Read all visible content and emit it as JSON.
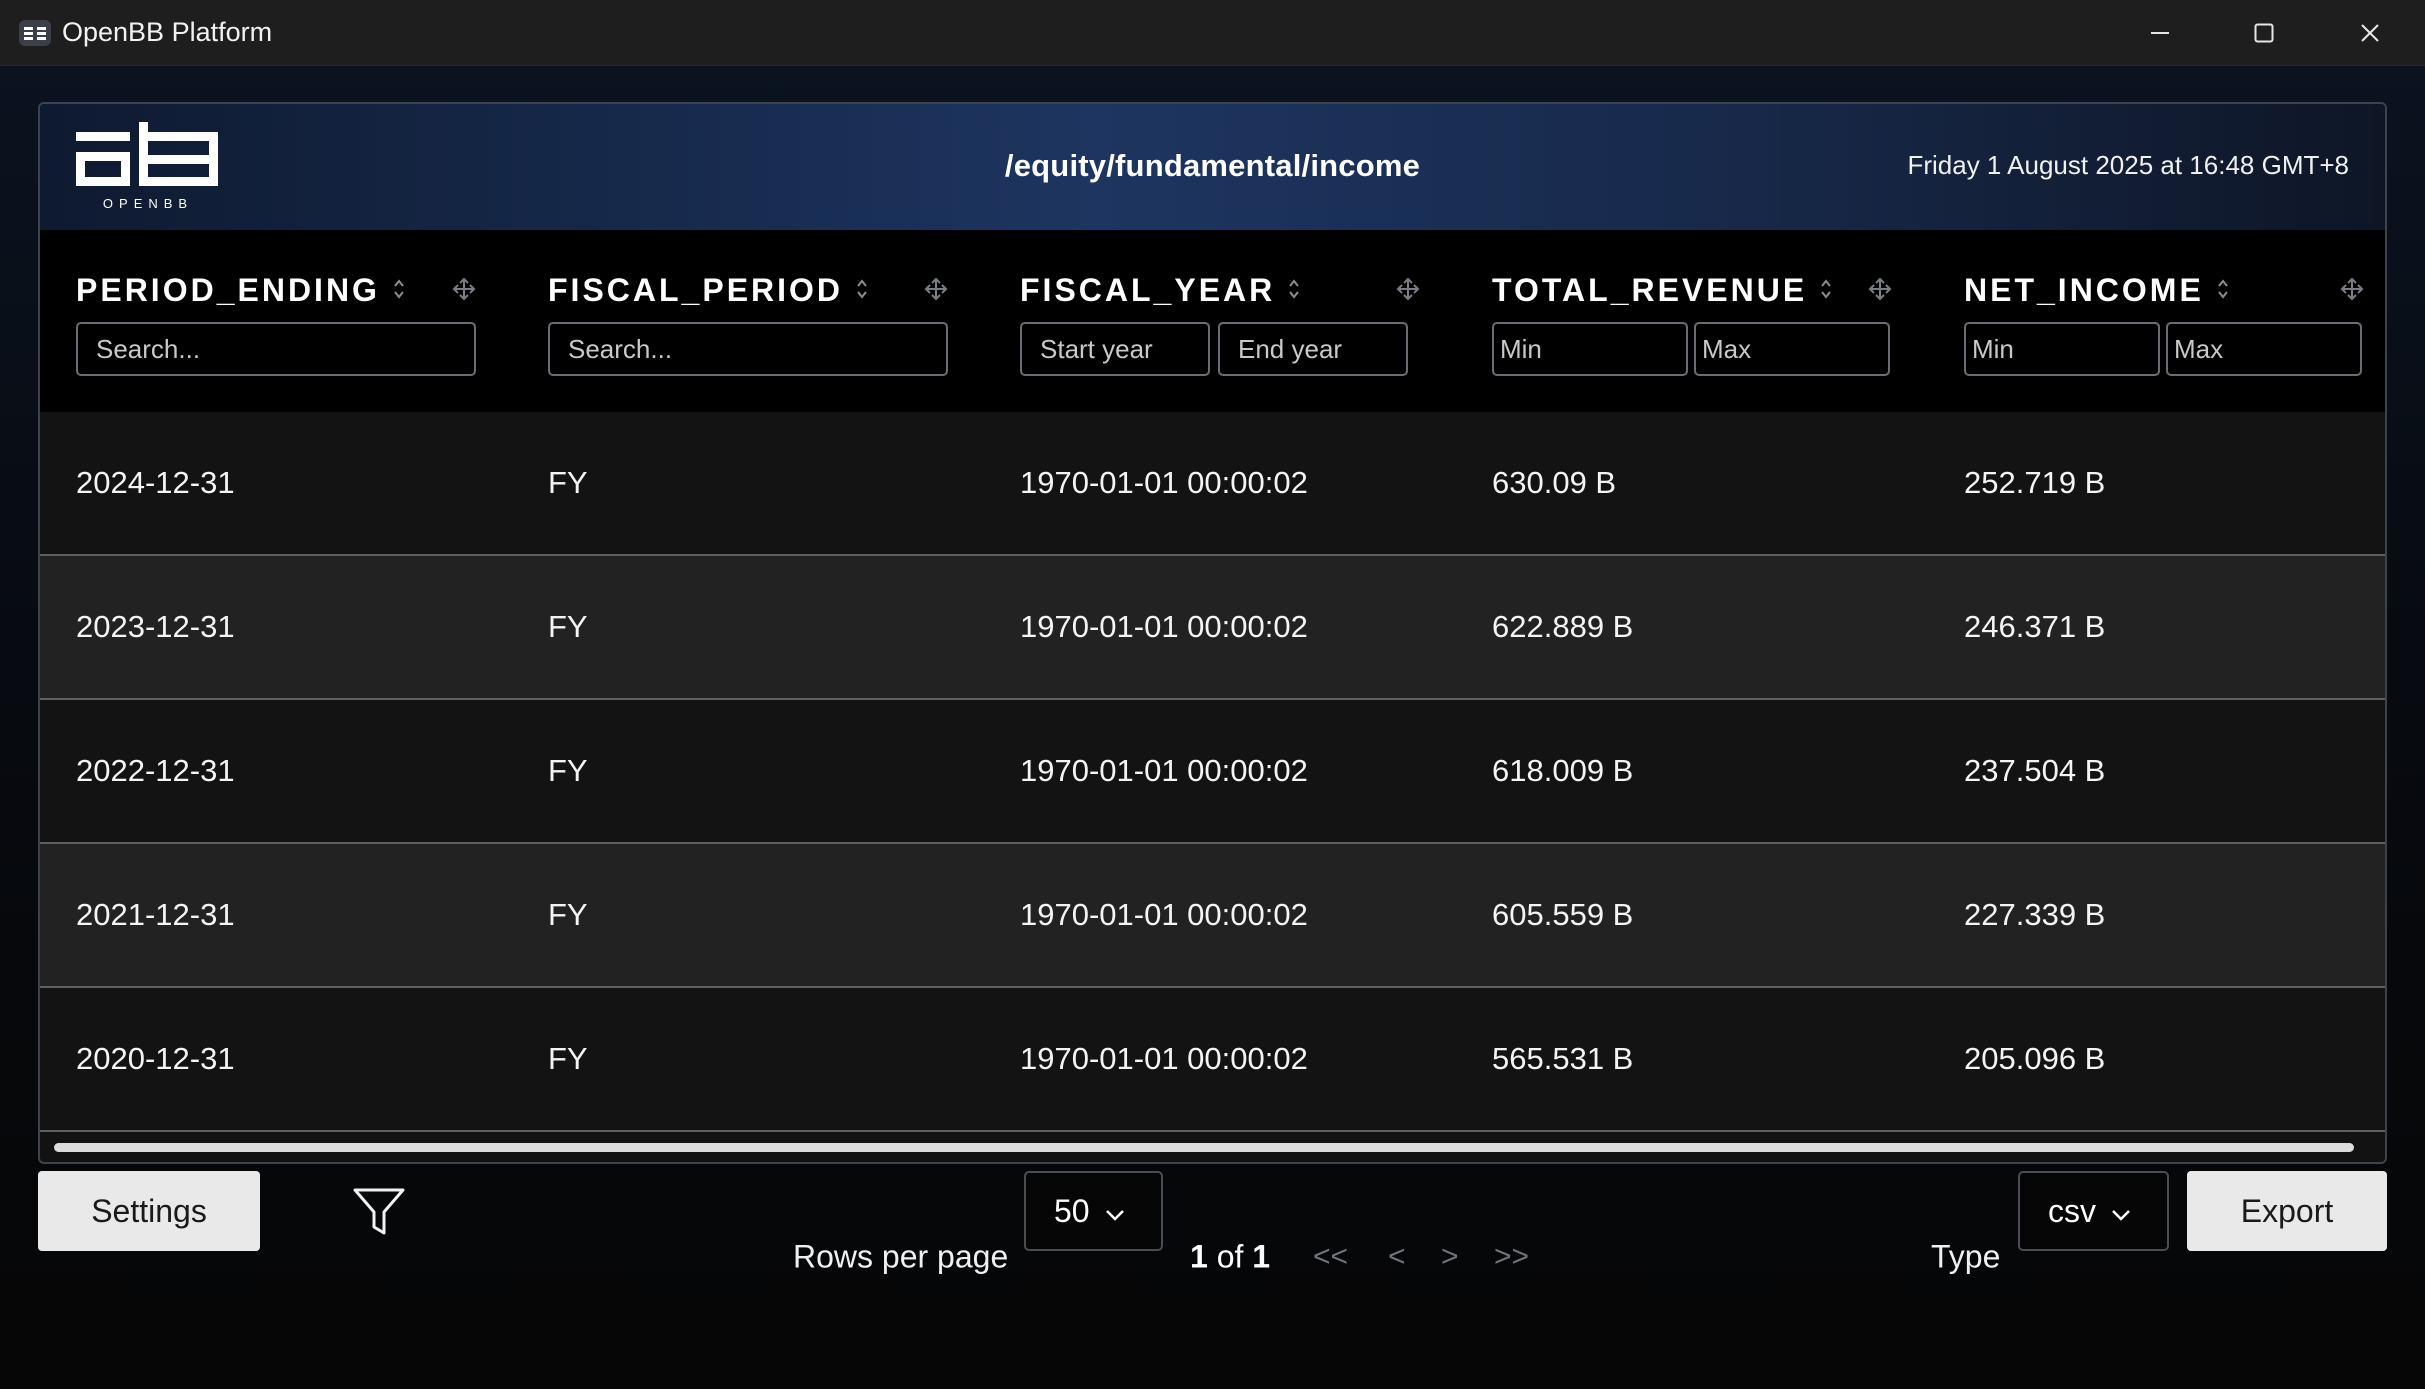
{
  "window": {
    "title": "OpenBB Platform",
    "controls": [
      "minimize-icon",
      "maximize-icon",
      "close-icon"
    ]
  },
  "header": {
    "logo_text": "OPENBB",
    "route": "/equity/fundamental/income",
    "datetime": "Friday 1 August 2025 at 16:48 GMT+8"
  },
  "columns": [
    {
      "key": "period_ending",
      "label": "PERIOD_ENDING",
      "filters": [
        {
          "placeholder": "Search..."
        }
      ]
    },
    {
      "key": "fiscal_period",
      "label": "FISCAL_PERIOD",
      "filters": [
        {
          "placeholder": "Search..."
        }
      ]
    },
    {
      "key": "fiscal_year",
      "label": "FISCAL_YEAR",
      "filters": [
        {
          "placeholder": "Start year"
        },
        {
          "placeholder": "End year"
        }
      ]
    },
    {
      "key": "total_revenue",
      "label": "TOTAL_REVENUE",
      "filters": [
        {
          "placeholder": "Min"
        },
        {
          "placeholder": "Max"
        }
      ]
    },
    {
      "key": "net_income",
      "label": "NET_INCOME",
      "filters": [
        {
          "placeholder": "Min"
        },
        {
          "placeholder": "Max"
        }
      ]
    }
  ],
  "rows": [
    [
      "2024-12-31",
      "FY",
      "1970-01-01 00:00:02",
      "630.09 B",
      "252.719 B"
    ],
    [
      "2023-12-31",
      "FY",
      "1970-01-01 00:00:02",
      "622.889 B",
      "246.371 B"
    ],
    [
      "2022-12-31",
      "FY",
      "1970-01-01 00:00:02",
      "618.009 B",
      "237.504 B"
    ],
    [
      "2021-12-31",
      "FY",
      "1970-01-01 00:00:02",
      "605.559 B",
      "227.339 B"
    ],
    [
      "2020-12-31",
      "FY",
      "1970-01-01 00:00:02",
      "565.531 B",
      "205.096 B"
    ]
  ],
  "footer": {
    "settings_label": "Settings",
    "rows_per_page_label": "Rows per page",
    "rows_per_page_value": "50",
    "page_current": "1",
    "page_of": "of",
    "page_total": "1",
    "pager": {
      "first": "<<",
      "prev": "<",
      "next": ">",
      "last": ">>"
    },
    "type_label": "Type",
    "type_value": "csv",
    "export_label": "Export"
  },
  "colors": {
    "accent_header": "#1d3560",
    "row_odd": "#131313",
    "row_even": "#222223",
    "button_light": "#e9e9ea",
    "pager_disabled": "#6f737a"
  }
}
